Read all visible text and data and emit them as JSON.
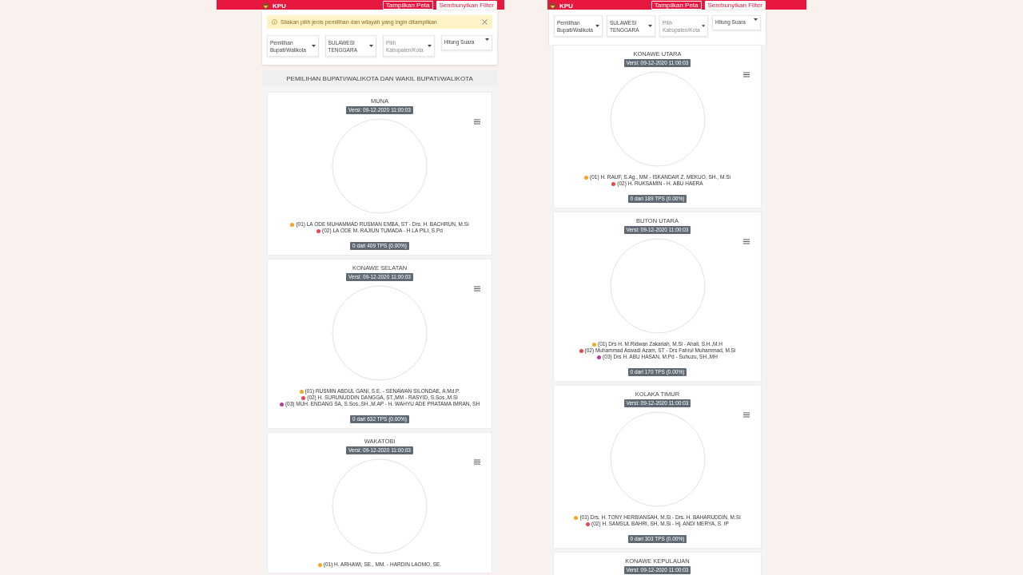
{
  "screens": [
    {
      "header": {
        "brand": "KPU",
        "buttons": [
          {
            "label": "Tampilkan Peta",
            "kind": "outline"
          },
          {
            "label": "Sembunyikan Filter",
            "kind": "solid"
          }
        ]
      },
      "alert": {
        "message": "Silakan pilih jenis pemilihan dan wilayah yang ingin ditampilkan"
      },
      "filters": [
        {
          "value": "Pemilihan Bupati/Walikota"
        },
        {
          "value": "SULAWESI TENGGARA"
        },
        {
          "placeholder": "Pilih Kabupaten/Kota"
        },
        {
          "value": "Hitung Suara"
        }
      ],
      "section_title": "PEMILIHAN BUPATI/WALIKOTA DAN WAKIL BUPATI/WALIKOTA",
      "regions": [
        {
          "name": "MUNA",
          "version": "Versi: 09-12-2020 11:00:03",
          "candidates": [
            {
              "label": "(01) LA ODE MUHAMMAD RUSMAN EMBA, ST - Drs. H. BACHRUN, M.Si",
              "color": "#f5a623"
            },
            {
              "label": "(02) LA ODE M. RAJIUN TUMADA - H LA PILI, S.Pd",
              "color": "#e8474f"
            }
          ],
          "tps": "0 dari 409 TPS (0.00%)"
        },
        {
          "name": "KONAWE SELATAN",
          "version": "Versi: 09-12-2020 11:00:03",
          "candidates": [
            {
              "label": "(01) RUSMIN ABDUL GANI, S.E. - SENAWAN SILONDAE, A.Md.P.",
              "color": "#f5a623"
            },
            {
              "label": "(02) H. SURUNUDDIN DANGGA, ST.,MM - RASYID, S.Sos.,M.Si",
              "color": "#e8474f"
            },
            {
              "label": "(03) MUH. ENDANG SA, S.Sos.,SH.,M.AP - H. WAHYU ADE PRATAMA IMRAN, SH",
              "color": "#b5409b"
            }
          ],
          "tps": "0 dari 632 TPS (0.00%)"
        },
        {
          "name": "WAKATOBI",
          "version": "Versi: 09-12-2020 11:00:03",
          "candidates": [
            {
              "label": "(01) H. ARHAWI, SE., MM. - HARDIN LAOMO, SE.",
              "color": "#f5a623"
            }
          ]
        }
      ]
    },
    {
      "header": {
        "brand": "KPU",
        "buttons": [
          {
            "label": "Tampilkan Peta",
            "kind": "outline"
          },
          {
            "label": "Sembunyikan Filter",
            "kind": "solid"
          }
        ]
      },
      "filters": [
        {
          "value": "Pemilihan Bupati/Walikota"
        },
        {
          "value": "SULAWESI TENGGARA"
        },
        {
          "placeholder": "Pilih Kabupaten/Kota"
        },
        {
          "value": "Hitung Suara"
        }
      ],
      "regions": [
        {
          "name": "KONAWE UTARA",
          "version": "Versi: 09-12-2020 11:00:03",
          "candidates": [
            {
              "label": "(01) H. RAUF, S.Ag., MM - ISKANDAR Z. MEKUO, SH., M.Si",
              "color": "#f5a623"
            },
            {
              "label": "(02) H. RUKSAMIN - H. ABU HAERA",
              "color": "#e8474f"
            }
          ],
          "tps": "0 dari 189 TPS (0.00%)"
        },
        {
          "name": "BUTON UTARA",
          "version": "Versi: 09-12-2020 11:00:03",
          "candidates": [
            {
              "label": "(01) Drs H. M.Ridwan Zakariah, M.Si - Ahali, S.H.,M.H",
              "color": "#f5a623"
            },
            {
              "label": "(02) Muhammad Aswadi Azam, ST - Drs Fahrul Muhammad, M.Si",
              "color": "#e8474f"
            },
            {
              "label": "(03) Drs H. ABU HASAN, M.Pd - Suhuzu, SH.,MH",
              "color": "#b5409b"
            }
          ],
          "tps": "0 dari 170 TPS (0.00%)"
        },
        {
          "name": "KOLAKA TIMUR",
          "version": "Versi: 09-12-2020 11:00:03",
          "candidates": [
            {
              "label": "(01) Drs. H. TONY HERBIANSAH, M.Si - Drs. H. BAHARUDDIN, M.Si",
              "color": "#f5a623"
            },
            {
              "label": "(02) H. SAMSUL BAHRI, SH, M.Si - Hj. ANDI MERYA, S. IP",
              "color": "#e8474f"
            }
          ],
          "tps": "0 dari 303 TPS (0.00%)"
        },
        {
          "name": "KONAWE KEPULAUAN",
          "version": "Versi: 09-12-2020 11:00:03"
        }
      ]
    }
  ]
}
